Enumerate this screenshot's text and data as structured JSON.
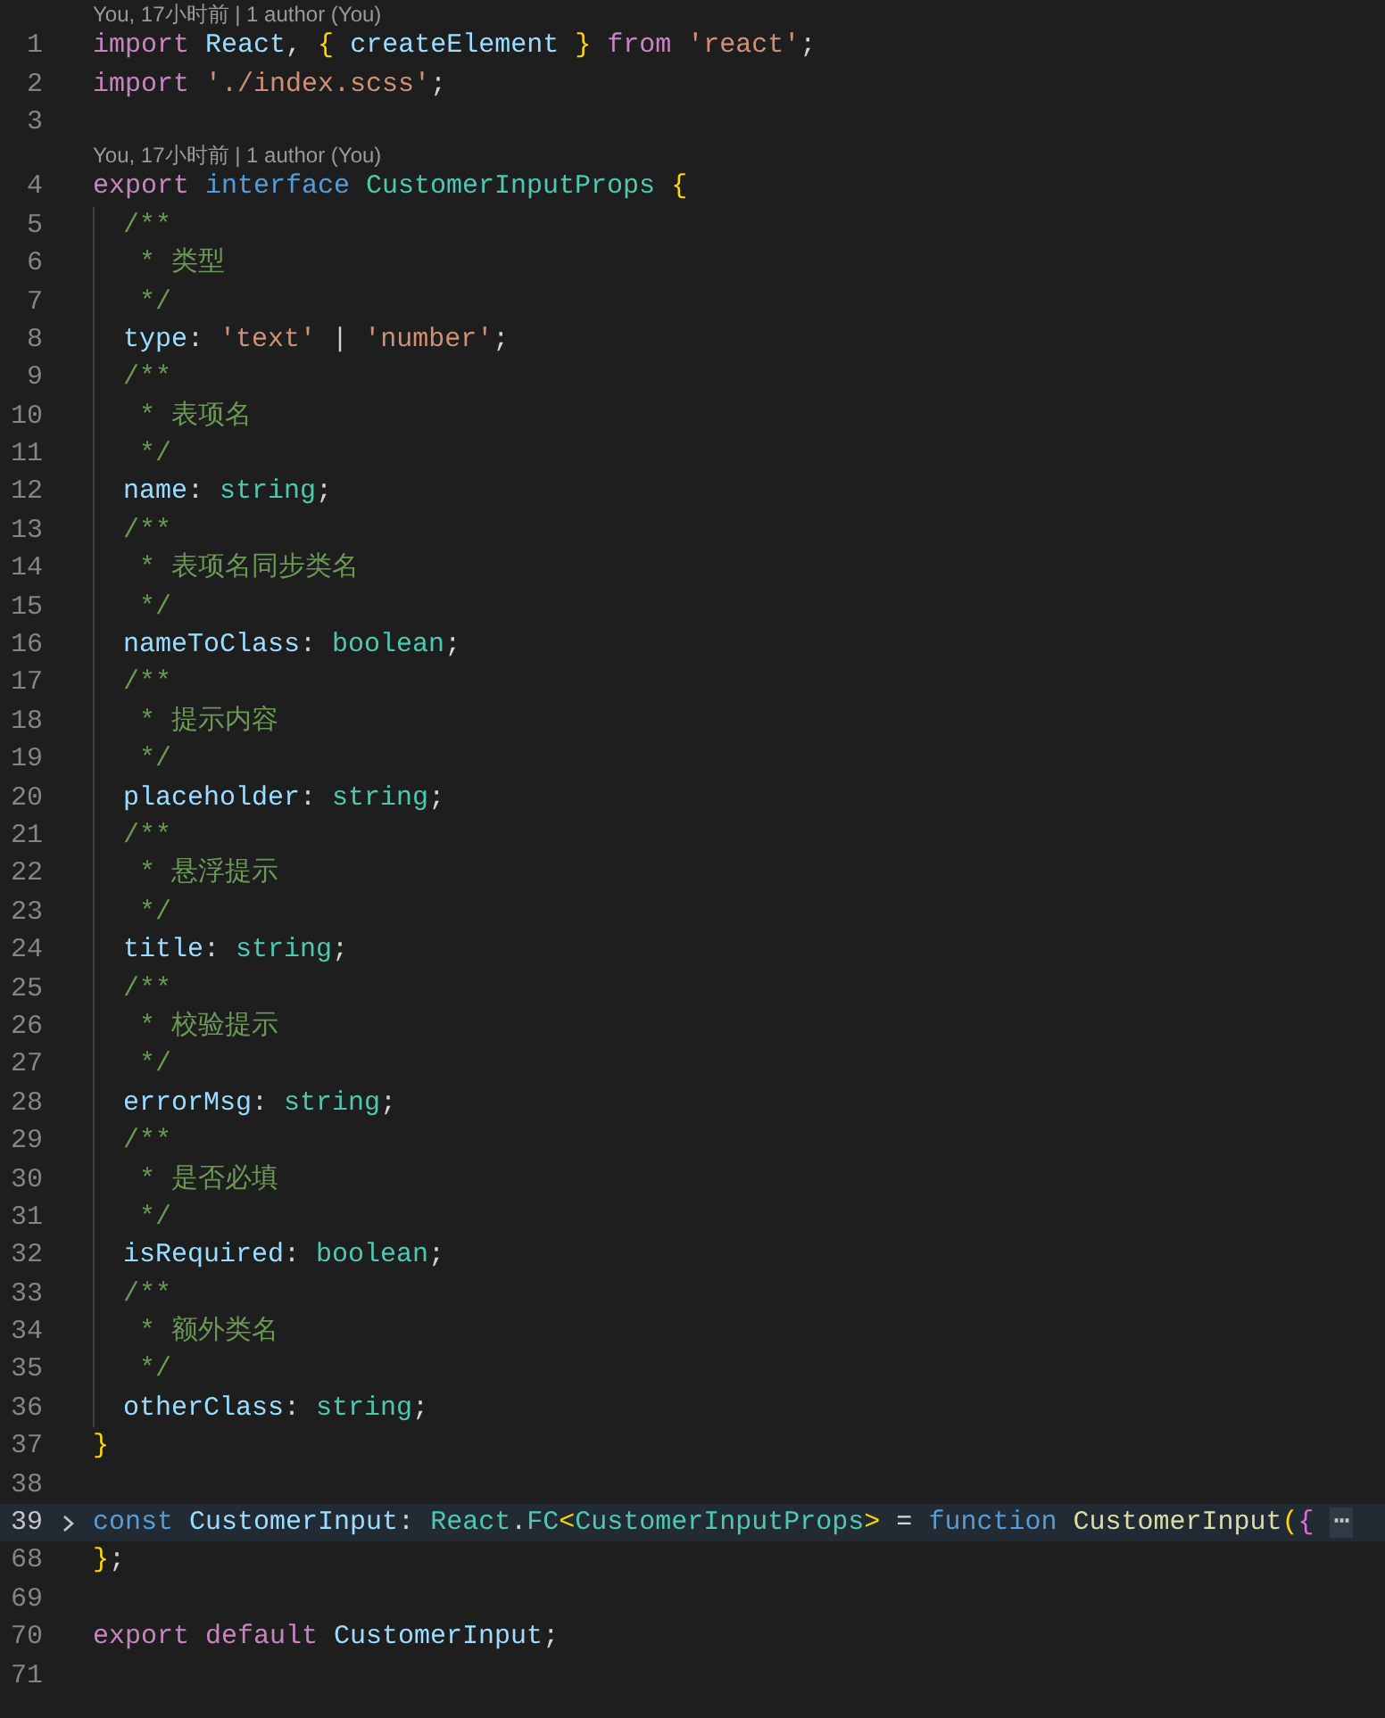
{
  "editor": {
    "lines": [
      {
        "kind": "lens",
        "text": "You, 17小时前 | 1 author (You)"
      },
      {
        "kind": "code",
        "number": "1",
        "indented": false,
        "folded": false,
        "current": false,
        "tokens": [
          {
            "kind": "kw",
            "text": "import"
          },
          {
            "kind": "va",
            "text": " React"
          },
          {
            "kind": "pu",
            "text": ","
          },
          {
            "kind": "b1",
            "text": " {"
          },
          {
            "kind": "va",
            "text": " createElement"
          },
          {
            "kind": "b1",
            "text": " }"
          },
          {
            "kind": "kw",
            "text": " from"
          },
          {
            "kind": "str",
            "text": " 'react'"
          },
          {
            "kind": "pu",
            "text": ";"
          }
        ]
      },
      {
        "kind": "code",
        "number": "2",
        "indented": false,
        "folded": false,
        "current": false,
        "tokens": [
          {
            "kind": "kw",
            "text": "import"
          },
          {
            "kind": "str",
            "text": " './index.scss'"
          },
          {
            "kind": "pu",
            "text": ";"
          }
        ]
      },
      {
        "kind": "code",
        "number": "3",
        "indented": false,
        "folded": false,
        "current": false
      },
      {
        "kind": "lens",
        "text": "You, 17小时前 | 1 author (You)"
      },
      {
        "kind": "code",
        "number": "4",
        "indented": false,
        "folded": false,
        "current": false,
        "tokens": [
          {
            "kind": "kw",
            "text": "export"
          },
          {
            "kind": "st",
            "text": " interface"
          },
          {
            "kind": "ty",
            "text": " CustomerInputProps"
          },
          {
            "kind": "b1",
            "text": " {"
          }
        ]
      },
      {
        "kind": "code",
        "number": "5",
        "indented": true,
        "folded": false,
        "current": false,
        "tokens": [
          {
            "kind": "cm",
            "text": "/**"
          }
        ]
      },
      {
        "kind": "code",
        "number": "6",
        "indented": true,
        "folded": false,
        "current": false,
        "tokens": [
          {
            "kind": "cm",
            "text": " * 类型"
          }
        ]
      },
      {
        "kind": "code",
        "number": "7",
        "indented": true,
        "folded": false,
        "current": false,
        "tokens": [
          {
            "kind": "cm",
            "text": " */"
          }
        ]
      },
      {
        "kind": "code",
        "number": "8",
        "indented": true,
        "folded": false,
        "current": false,
        "tokens": [
          {
            "kind": "va",
            "text": "type"
          },
          {
            "kind": "pu",
            "text": ":"
          },
          {
            "kind": "str",
            "text": " 'text'"
          },
          {
            "kind": "pu",
            "text": " |"
          },
          {
            "kind": "str",
            "text": " 'number'"
          },
          {
            "kind": "pu",
            "text": ";"
          }
        ]
      },
      {
        "kind": "code",
        "number": "9",
        "indented": true,
        "folded": false,
        "current": false,
        "tokens": [
          {
            "kind": "cm",
            "text": "/**"
          }
        ]
      },
      {
        "kind": "code",
        "number": "10",
        "indented": true,
        "folded": false,
        "current": false,
        "tokens": [
          {
            "kind": "cm",
            "text": " * 表项名"
          }
        ]
      },
      {
        "kind": "code",
        "number": "11",
        "indented": true,
        "folded": false,
        "current": false,
        "tokens": [
          {
            "kind": "cm",
            "text": " */"
          }
        ]
      },
      {
        "kind": "code",
        "number": "12",
        "indented": true,
        "folded": false,
        "current": false,
        "tokens": [
          {
            "kind": "va",
            "text": "name"
          },
          {
            "kind": "pu",
            "text": ":"
          },
          {
            "kind": "ty",
            "text": " string"
          },
          {
            "kind": "pu",
            "text": ";"
          }
        ]
      },
      {
        "kind": "code",
        "number": "13",
        "indented": true,
        "folded": false,
        "current": false,
        "tokens": [
          {
            "kind": "cm",
            "text": "/**"
          }
        ]
      },
      {
        "kind": "code",
        "number": "14",
        "indented": true,
        "folded": false,
        "current": false,
        "tokens": [
          {
            "kind": "cm",
            "text": " * 表项名同步类名"
          }
        ]
      },
      {
        "kind": "code",
        "number": "15",
        "indented": true,
        "folded": false,
        "current": false,
        "tokens": [
          {
            "kind": "cm",
            "text": " */"
          }
        ]
      },
      {
        "kind": "code",
        "number": "16",
        "indented": true,
        "folded": false,
        "current": false,
        "tokens": [
          {
            "kind": "va",
            "text": "nameToClass"
          },
          {
            "kind": "pu",
            "text": ":"
          },
          {
            "kind": "ty",
            "text": " boolean"
          },
          {
            "kind": "pu",
            "text": ";"
          }
        ]
      },
      {
        "kind": "code",
        "number": "17",
        "indented": true,
        "folded": false,
        "current": false,
        "tokens": [
          {
            "kind": "cm",
            "text": "/**"
          }
        ]
      },
      {
        "kind": "code",
        "number": "18",
        "indented": true,
        "folded": false,
        "current": false,
        "tokens": [
          {
            "kind": "cm",
            "text": " * 提示内容"
          }
        ]
      },
      {
        "kind": "code",
        "number": "19",
        "indented": true,
        "folded": false,
        "current": false,
        "tokens": [
          {
            "kind": "cm",
            "text": " */"
          }
        ]
      },
      {
        "kind": "code",
        "number": "20",
        "indented": true,
        "folded": false,
        "current": false,
        "tokens": [
          {
            "kind": "va",
            "text": "placeholder"
          },
          {
            "kind": "pu",
            "text": ":"
          },
          {
            "kind": "ty",
            "text": " string"
          },
          {
            "kind": "pu",
            "text": ";"
          }
        ]
      },
      {
        "kind": "code",
        "number": "21",
        "indented": true,
        "folded": false,
        "current": false,
        "tokens": [
          {
            "kind": "cm",
            "text": "/**"
          }
        ]
      },
      {
        "kind": "code",
        "number": "22",
        "indented": true,
        "folded": false,
        "current": false,
        "tokens": [
          {
            "kind": "cm",
            "text": " * 悬浮提示"
          }
        ]
      },
      {
        "kind": "code",
        "number": "23",
        "indented": true,
        "folded": false,
        "current": false,
        "tokens": [
          {
            "kind": "cm",
            "text": " */"
          }
        ]
      },
      {
        "kind": "code",
        "number": "24",
        "indented": true,
        "folded": false,
        "current": false,
        "tokens": [
          {
            "kind": "va",
            "text": "title"
          },
          {
            "kind": "pu",
            "text": ":"
          },
          {
            "kind": "ty",
            "text": " string"
          },
          {
            "kind": "pu",
            "text": ";"
          }
        ]
      },
      {
        "kind": "code",
        "number": "25",
        "indented": true,
        "folded": false,
        "current": false,
        "tokens": [
          {
            "kind": "cm",
            "text": "/**"
          }
        ]
      },
      {
        "kind": "code",
        "number": "26",
        "indented": true,
        "folded": false,
        "current": false,
        "tokens": [
          {
            "kind": "cm",
            "text": " * 校验提示"
          }
        ]
      },
      {
        "kind": "code",
        "number": "27",
        "indented": true,
        "folded": false,
        "current": false,
        "tokens": [
          {
            "kind": "cm",
            "text": " */"
          }
        ]
      },
      {
        "kind": "code",
        "number": "28",
        "indented": true,
        "folded": false,
        "current": false,
        "tokens": [
          {
            "kind": "va",
            "text": "errorMsg"
          },
          {
            "kind": "pu",
            "text": ":"
          },
          {
            "kind": "ty",
            "text": " string"
          },
          {
            "kind": "pu",
            "text": ";"
          }
        ]
      },
      {
        "kind": "code",
        "number": "29",
        "indented": true,
        "folded": false,
        "current": false,
        "tokens": [
          {
            "kind": "cm",
            "text": "/**"
          }
        ]
      },
      {
        "kind": "code",
        "number": "30",
        "indented": true,
        "folded": false,
        "current": false,
        "tokens": [
          {
            "kind": "cm",
            "text": " * 是否必填"
          }
        ]
      },
      {
        "kind": "code",
        "number": "31",
        "indented": true,
        "folded": false,
        "current": false,
        "tokens": [
          {
            "kind": "cm",
            "text": " */"
          }
        ]
      },
      {
        "kind": "code",
        "number": "32",
        "indented": true,
        "folded": false,
        "current": false,
        "tokens": [
          {
            "kind": "va",
            "text": "isRequired"
          },
          {
            "kind": "pu",
            "text": ":"
          },
          {
            "kind": "ty",
            "text": " boolean"
          },
          {
            "kind": "pu",
            "text": ";"
          }
        ]
      },
      {
        "kind": "code",
        "number": "33",
        "indented": true,
        "folded": false,
        "current": false,
        "tokens": [
          {
            "kind": "cm",
            "text": "/**"
          }
        ]
      },
      {
        "kind": "code",
        "number": "34",
        "indented": true,
        "folded": false,
        "current": false,
        "tokens": [
          {
            "kind": "cm",
            "text": " * 额外类名"
          }
        ]
      },
      {
        "kind": "code",
        "number": "35",
        "indented": true,
        "folded": false,
        "current": false,
        "tokens": [
          {
            "kind": "cm",
            "text": " */"
          }
        ]
      },
      {
        "kind": "code",
        "number": "36",
        "indented": true,
        "folded": false,
        "current": false,
        "tokens": [
          {
            "kind": "va",
            "text": "otherClass"
          },
          {
            "kind": "pu",
            "text": ":"
          },
          {
            "kind": "ty",
            "text": " string"
          },
          {
            "kind": "pu",
            "text": ";"
          }
        ]
      },
      {
        "kind": "code",
        "number": "37",
        "indented": false,
        "folded": false,
        "current": false,
        "tokens": [
          {
            "kind": "b1",
            "text": "}"
          }
        ]
      },
      {
        "kind": "code",
        "number": "38",
        "indented": false,
        "folded": false,
        "current": false
      },
      {
        "kind": "code",
        "number": "39",
        "indented": false,
        "folded": true,
        "current": true,
        "tokens": [
          {
            "kind": "st",
            "text": "const"
          },
          {
            "kind": "va",
            "text": " CustomerInput"
          },
          {
            "kind": "pu",
            "text": ":"
          },
          {
            "kind": "ty",
            "text": " React"
          },
          {
            "kind": "pu",
            "text": "."
          },
          {
            "kind": "ty",
            "text": "FC"
          },
          {
            "kind": "b1",
            "text": "<"
          },
          {
            "kind": "ty",
            "text": "CustomerInputProps"
          },
          {
            "kind": "b1",
            "text": ">"
          },
          {
            "kind": "pu",
            "text": " ="
          },
          {
            "kind": "st",
            "text": " function"
          },
          {
            "kind": "fn",
            "text": " CustomerInput"
          },
          {
            "kind": "b1",
            "text": "("
          },
          {
            "kind": "b2",
            "text": "{"
          },
          {
            "kind": "ell",
            "text": "⋯"
          }
        ]
      },
      {
        "kind": "code",
        "number": "68",
        "indented": false,
        "folded": false,
        "current": false,
        "tokens": [
          {
            "kind": "b1",
            "text": "}"
          },
          {
            "kind": "pu",
            "text": ";"
          }
        ]
      },
      {
        "kind": "code",
        "number": "69",
        "indented": false,
        "folded": false,
        "current": false
      },
      {
        "kind": "code",
        "number": "70",
        "indented": false,
        "folded": false,
        "current": false,
        "tokens": [
          {
            "kind": "kw",
            "text": "export"
          },
          {
            "kind": "kw",
            "text": " default"
          },
          {
            "kind": "va",
            "text": " CustomerInput"
          },
          {
            "kind": "pu",
            "text": ";"
          }
        ]
      },
      {
        "kind": "code",
        "number": "71",
        "indented": false,
        "folded": false,
        "current": false
      }
    ]
  }
}
